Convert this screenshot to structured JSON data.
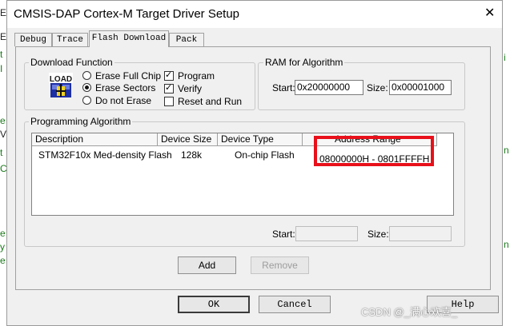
{
  "window": {
    "title": "CMSIS-DAP Cortex-M Target Driver Setup",
    "close_glyph": "✕"
  },
  "tabs": [
    {
      "label": "Debug",
      "active": false
    },
    {
      "label": "Trace",
      "active": false
    },
    {
      "label": "Flash Download",
      "active": true
    },
    {
      "label": "Pack",
      "active": false
    }
  ],
  "download_function": {
    "legend": "Download Function",
    "icon_text": "LOAD",
    "radios": [
      {
        "label": "Erase Full Chip",
        "checked": false
      },
      {
        "label": "Erase Sectors",
        "checked": true
      },
      {
        "label": "Do not Erase",
        "checked": false
      }
    ],
    "checkboxes": [
      {
        "label": "Program",
        "checked": true
      },
      {
        "label": "Verify",
        "checked": true
      },
      {
        "label": "Reset and Run",
        "checked": false
      }
    ]
  },
  "ram_for_algorithm": {
    "legend": "RAM for Algorithm",
    "start_label": "Start:",
    "start_value": "0x20000000",
    "size_label": "Size:",
    "size_value": "0x00001000"
  },
  "programming_algorithm": {
    "legend": "Programming Algorithm",
    "columns": [
      "Description",
      "Device Size",
      "Device Type",
      "Address Range"
    ],
    "rows": [
      {
        "description": "STM32F10x Med-density Flash",
        "device_size": "128k",
        "device_type": "On-chip Flash",
        "address_range": "08000000H - 0801FFFFH"
      }
    ],
    "start_label": "Start:",
    "start_value": "",
    "size_label": "Size:",
    "size_value": ""
  },
  "buttons": {
    "add": "Add",
    "remove": "Remove",
    "ok": "OK",
    "cancel": "Cancel",
    "help": "Help"
  },
  "watermark": "CSDN @_满心欢喜_",
  "colors": {
    "highlight": "#e8101a",
    "dialog_bg": "#f0f0f0"
  }
}
